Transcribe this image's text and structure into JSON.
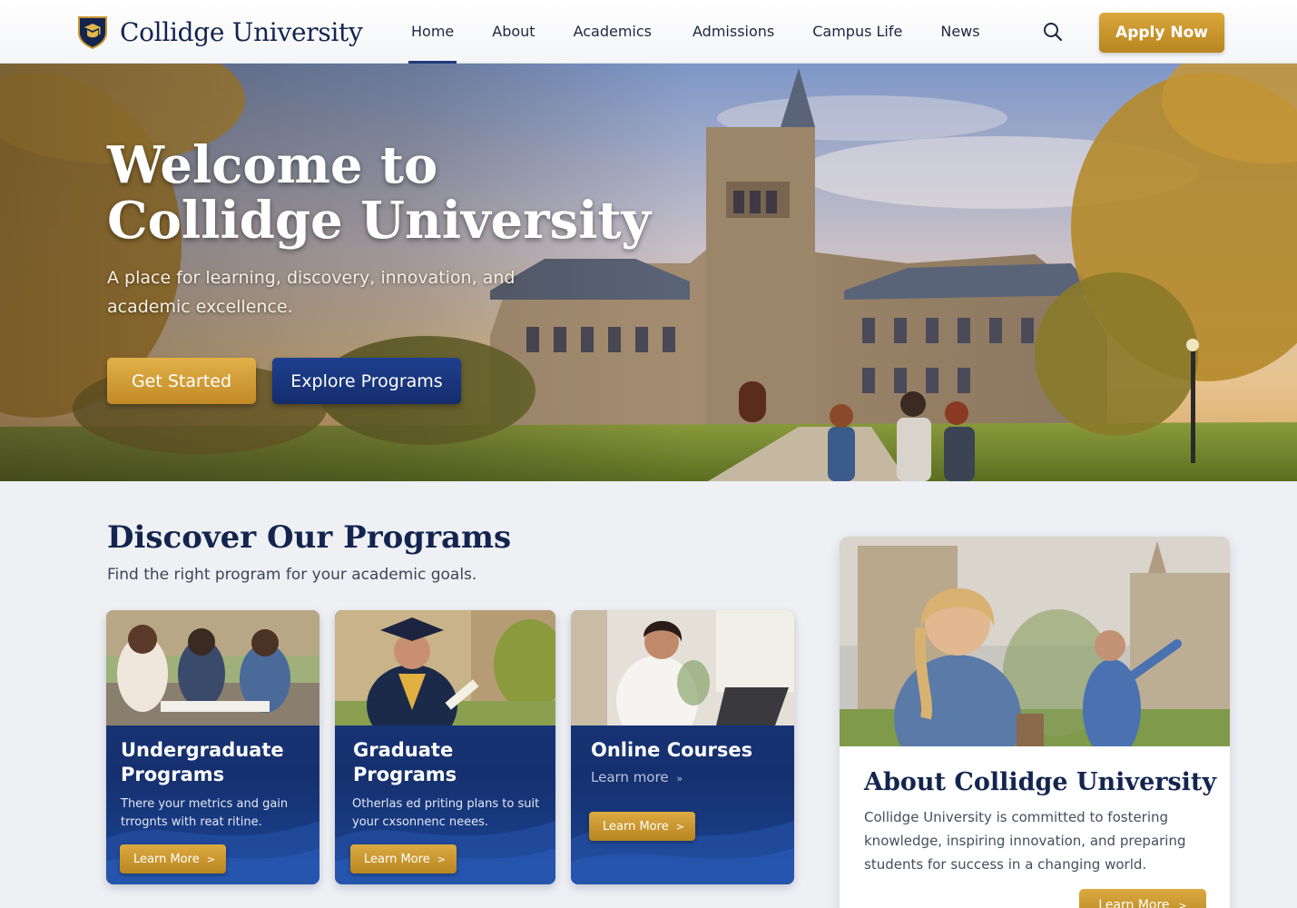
{
  "header": {
    "brand_name": "Collidge University",
    "nav": [
      "Home",
      "About",
      "Academics",
      "Admissions",
      "Campus Life",
      "News"
    ],
    "active_nav": "Home",
    "apply_label": "Apply Now",
    "search_icon": "search-icon"
  },
  "hero": {
    "title": "Welcome to Collidge University",
    "subtitle": "A place for learning, discovery, innovation, and academic excellence.",
    "primary_cta": "Get Started",
    "secondary_cta": "Explore Programs"
  },
  "programs": {
    "title": "Discover Our Programs",
    "subtitle": "Find the right program for your academic goals.",
    "cards": [
      {
        "title": "Undergraduate Programs",
        "description": "There your metrics and gain trrognts with reat ritine.",
        "button": "Learn More"
      },
      {
        "title": "Graduate Programs",
        "description": "Otherlas ed priting plans to suit your cxsonnenc neees.",
        "button": "Learn More"
      },
      {
        "title": "Online Courses",
        "link": "Learn more",
        "button": "Learn More"
      }
    ]
  },
  "about": {
    "title": "About Collidge University",
    "text": "Collidge University is committed to fostering knowledge, inspiring innovation, and preparing students for success in a changing world.",
    "button": "Learn More"
  },
  "colors": {
    "navy": "#13254f",
    "gold": "#c9952e",
    "button_navy": "#1a3780"
  }
}
